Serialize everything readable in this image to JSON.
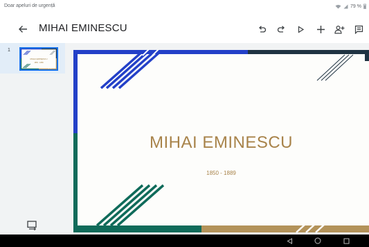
{
  "status_bar": {
    "carrier_text": "Doar apeluri de urgență",
    "battery_text": "79 %",
    "icons": [
      "wifi-icon",
      "signal-icon",
      "battery-icon"
    ]
  },
  "toolbar": {
    "title": "MIHAI EMINESCU",
    "icons": [
      "back-arrow-icon",
      "undo-icon",
      "redo-icon",
      "play-icon",
      "add-icon",
      "add-person-icon",
      "comment-icon"
    ]
  },
  "sidebar": {
    "slides": [
      {
        "number": "1",
        "title": "MIHAI EMINESCU",
        "subtitle": "1850 - 1889",
        "selected": true
      }
    ],
    "new_slide_icon": "new-slide-icon"
  },
  "slide": {
    "title": "MIHAI EMINESCU",
    "subtitle": "1850 - 1889",
    "colors": {
      "blue": "#2340c8",
      "teal": "#0f6b5a",
      "navy": "#1f3342",
      "gold": "#b3935a",
      "text": "#a8834a"
    }
  },
  "nav_bar": {
    "icons": [
      "back-triangle-icon",
      "home-circle-icon",
      "recents-square-icon"
    ]
  }
}
